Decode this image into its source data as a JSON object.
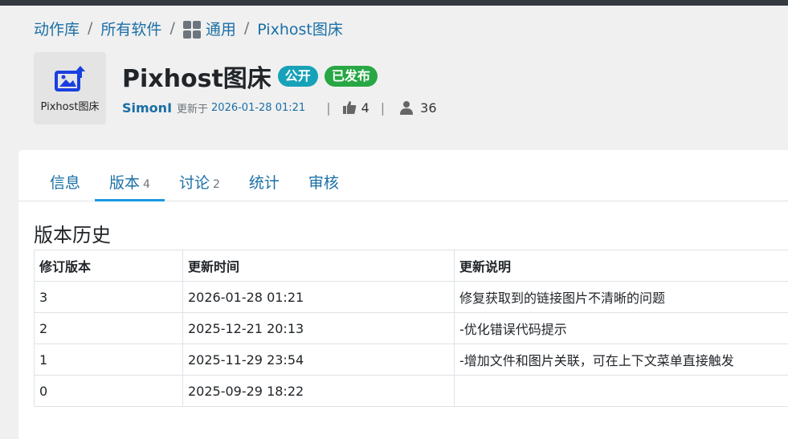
{
  "breadcrumb": {
    "items": [
      "动作库",
      "所有软件",
      "通用",
      "Pixhost图床"
    ],
    "sep": "/"
  },
  "app": {
    "icon_name": "image-upload-icon",
    "icon_label": "Pixhost图床",
    "title": "Pixhost图床",
    "badges": {
      "public": "公开",
      "published": "已发布"
    },
    "author": "SimonI",
    "updated_prefix": "更新于",
    "updated_at": "2026-01-28 01:21",
    "likes": "4",
    "users": "36",
    "divider": "|"
  },
  "tabs": [
    {
      "label": "信息",
      "count": ""
    },
    {
      "label": "版本",
      "count": "4"
    },
    {
      "label": "讨论",
      "count": "2"
    },
    {
      "label": "统计",
      "count": ""
    },
    {
      "label": "审核",
      "count": ""
    }
  ],
  "history": {
    "title": "版本历史",
    "headers": [
      "修订版本",
      "更新时间",
      "更新说明"
    ],
    "rows": [
      [
        "3",
        "2026-01-28 01:21",
        "修复获取到的链接图片不清晰的问题"
      ],
      [
        "2",
        "2025-12-21 20:13",
        "-优化错误代码提示"
      ],
      [
        "1",
        "2025-11-29 23:54",
        "-增加文件和图片关联，可在上下文菜单直接触发"
      ],
      [
        "0",
        "2025-09-29 18:22",
        ""
      ]
    ]
  },
  "colors": {
    "link": "#1a6fa6",
    "public_badge": "#17a2b8",
    "published_badge": "#28a745",
    "tab_active": "#1a9be0"
  }
}
